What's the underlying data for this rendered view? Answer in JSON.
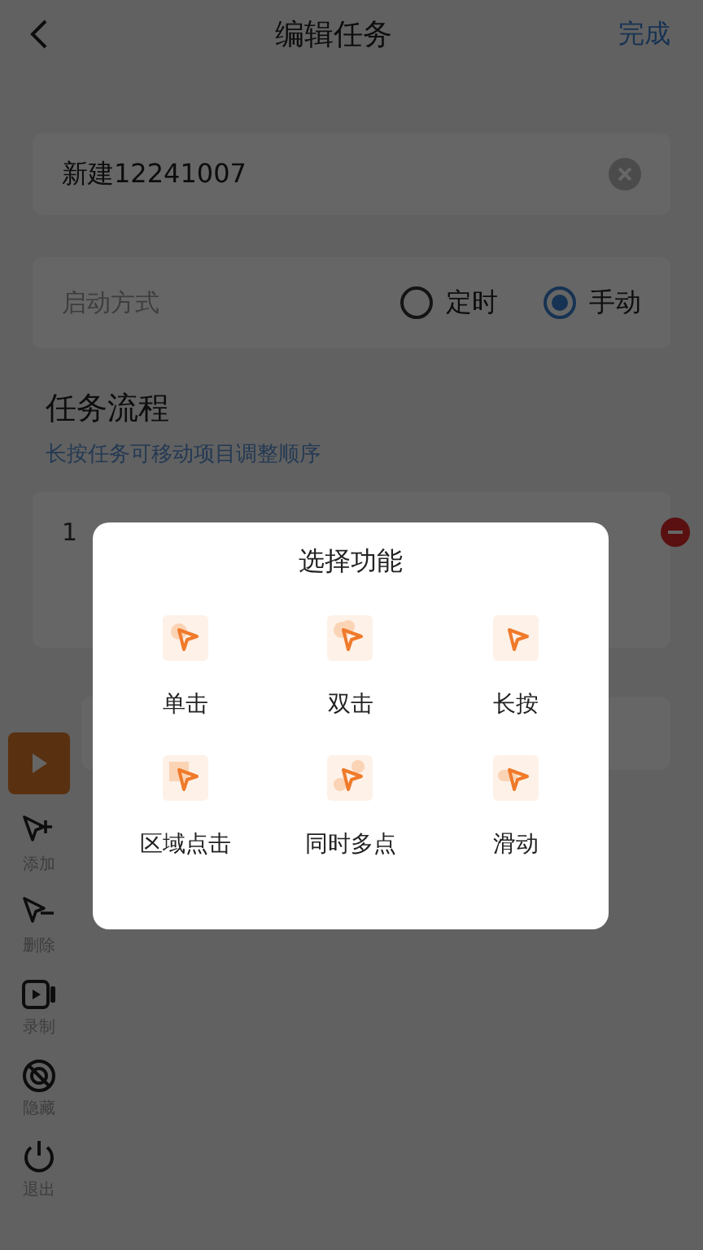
{
  "nav": {
    "title": "编辑任务",
    "done": "完成"
  },
  "name_field": {
    "value": "新建12241007"
  },
  "start_mode": {
    "label": "启动方式",
    "options": [
      {
        "label": "定时",
        "selected": false
      },
      {
        "label": "手动",
        "selected": true
      }
    ]
  },
  "flow": {
    "title": "任务流程",
    "hint": "长按任务可移动项目调整顺序",
    "items": [
      {
        "index": "1"
      }
    ]
  },
  "toolbar": {
    "items": [
      {
        "kind": "play"
      },
      {
        "kind": "add",
        "label": "添加"
      },
      {
        "kind": "remove",
        "label": "删除"
      },
      {
        "kind": "record",
        "label": "录制"
      },
      {
        "kind": "hide",
        "label": "隐藏"
      },
      {
        "kind": "exit",
        "label": "退出"
      }
    ]
  },
  "dialog": {
    "title": "选择功能",
    "options": [
      {
        "kind": "tap",
        "label": "单击"
      },
      {
        "kind": "double",
        "label": "双击"
      },
      {
        "kind": "long",
        "label": "长按"
      },
      {
        "kind": "area",
        "label": "区域点击"
      },
      {
        "kind": "multi",
        "label": "同时多点"
      },
      {
        "kind": "swipe",
        "label": "滑动"
      }
    ]
  }
}
